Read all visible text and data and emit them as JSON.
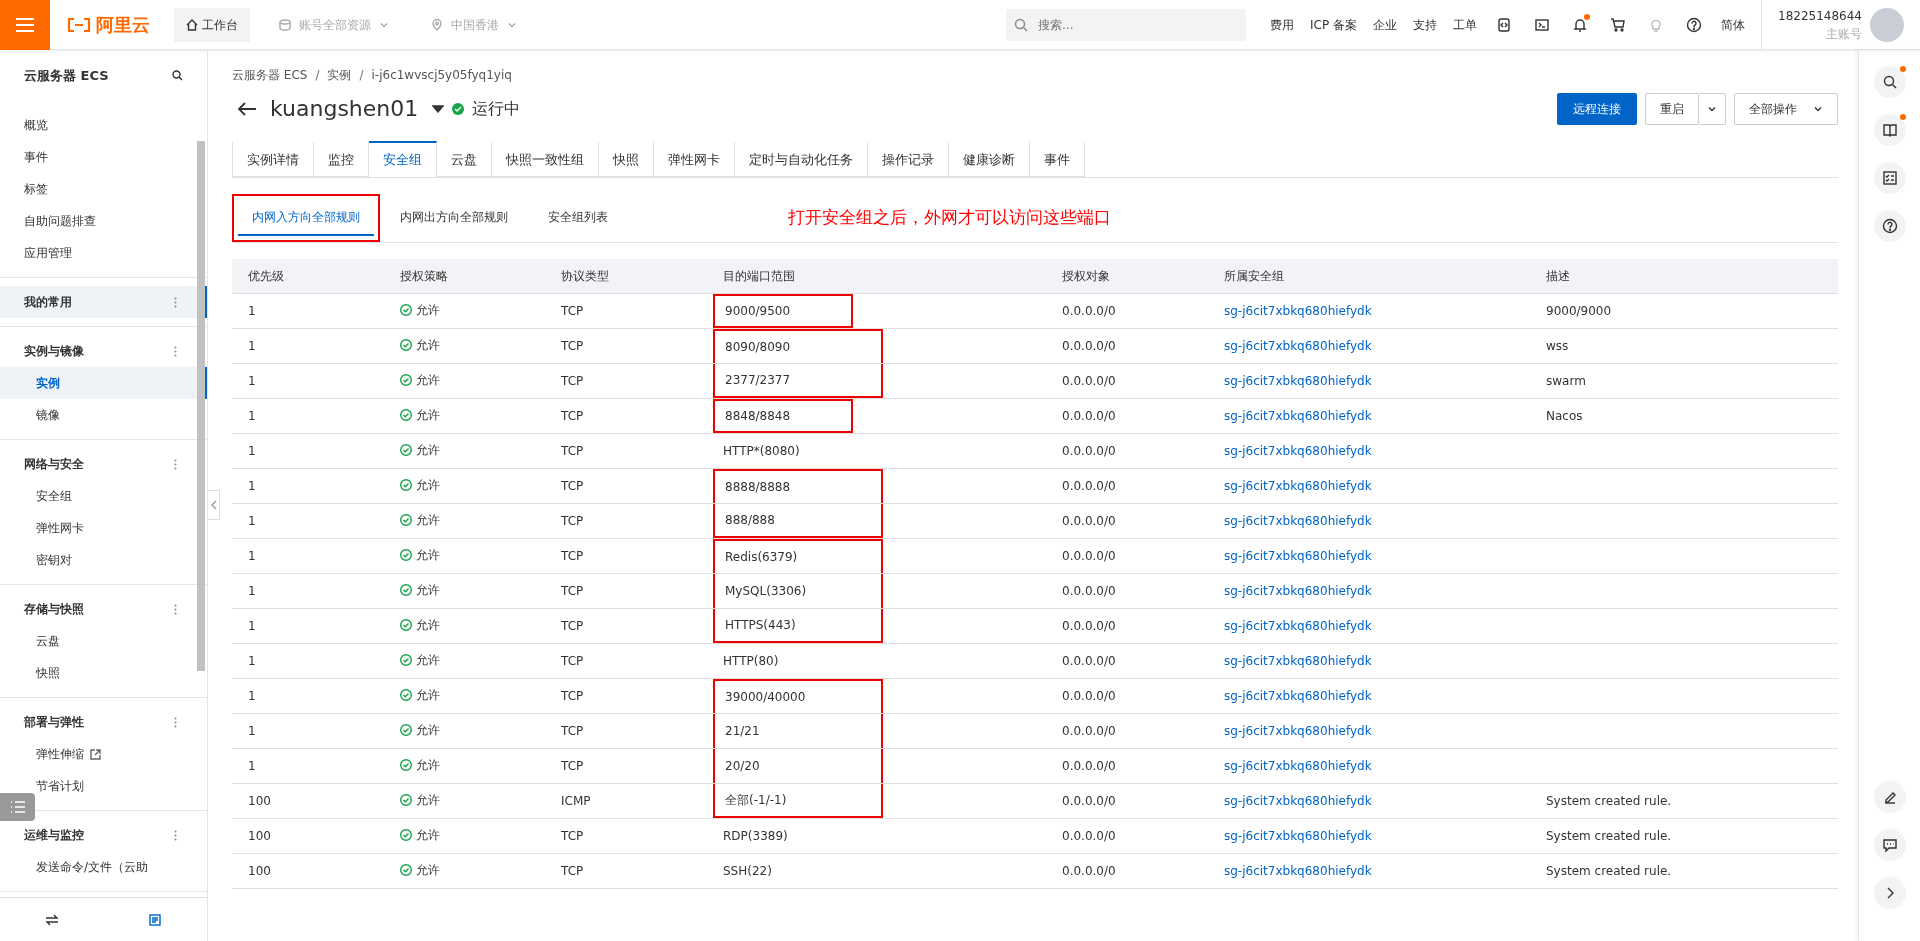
{
  "top_bar": {
    "logo": "阿里云",
    "workbench": "工作台",
    "resource_scope": "账号全部资源",
    "region": "中国香港",
    "search": {
      "placeholder": "搜索..."
    },
    "links": [
      "费用",
      "ICP 备案",
      "企业",
      "支持",
      "工单"
    ],
    "icons": [
      {
        "kind": "code",
        "badge": false
      },
      {
        "kind": "terminal",
        "badge": false
      },
      {
        "kind": "bell",
        "badge": true
      },
      {
        "kind": "cart",
        "badge": false
      },
      {
        "kind": "bulb",
        "badge": false
      },
      {
        "kind": "help",
        "badge": false
      }
    ],
    "language": "简体",
    "user": {
      "account": "18225148644",
      "role": "主账号"
    }
  },
  "sidebar": {
    "title": "云服务器 ECS",
    "sections": [
      {
        "items": [
          {
            "label": "概览",
            "selected": false,
            "external": false
          },
          {
            "label": "事件",
            "selected": false,
            "external": false
          },
          {
            "label": "标签",
            "selected": false,
            "external": false
          },
          {
            "label": "自助问题排查",
            "selected": false,
            "external": false
          },
          {
            "label": "应用管理",
            "selected": false,
            "external": false
          }
        ]
      },
      {
        "heading": "我的常用",
        "selected": true
      },
      {
        "heading": "实例与镜像",
        "selected": false,
        "items": [
          {
            "label": "实例",
            "selected": true,
            "external": false
          },
          {
            "label": "镜像",
            "selected": false,
            "external": false
          }
        ]
      },
      {
        "heading": "网络与安全",
        "selected": false,
        "items": [
          {
            "label": "安全组",
            "selected": false,
            "external": false
          },
          {
            "label": "弹性网卡",
            "selected": false,
            "external": false
          },
          {
            "label": "密钥对",
            "selected": false,
            "external": false
          }
        ]
      },
      {
        "heading": "存储与快照",
        "selected": false,
        "items": [
          {
            "label": "云盘",
            "selected": false,
            "external": false
          },
          {
            "label": "快照",
            "selected": false,
            "external": false
          }
        ]
      },
      {
        "heading": "部署与弹性",
        "selected": false,
        "items": [
          {
            "label": "弹性伸缩",
            "selected": false,
            "external": true
          },
          {
            "label": "节省计划",
            "selected": false,
            "external": false
          }
        ]
      },
      {
        "heading": "运维与监控",
        "selected": false,
        "items": [
          {
            "label": "发送命令/文件（云助",
            "selected": false,
            "external": false
          }
        ]
      }
    ]
  },
  "breadcrumb": [
    {
      "label": "云服务器 ECS",
      "separator": "/"
    },
    {
      "label": "实例",
      "separator": "/"
    },
    {
      "label": "i-j6c1wvscj5y05fyq1yiq"
    }
  ],
  "instance": {
    "name": "kuangshen01",
    "status": "运行中"
  },
  "actions": {
    "primary": "远程连接",
    "restart": "重启",
    "all": "全部操作"
  },
  "tabs": [
    {
      "label": "实例详情",
      "selected": false
    },
    {
      "label": "监控",
      "selected": false
    },
    {
      "label": "安全组",
      "selected": true
    },
    {
      "label": "云盘",
      "selected": false
    },
    {
      "label": "快照一致性组",
      "selected": false
    },
    {
      "label": "快照",
      "selected": false
    },
    {
      "label": "弹性网卡",
      "selected": false
    },
    {
      "label": "定时与自动化任务",
      "selected": false
    },
    {
      "label": "操作记录",
      "selected": false
    },
    {
      "label": "健康诊断",
      "selected": false
    },
    {
      "label": "事件",
      "selected": false
    }
  ],
  "sub_tabs": [
    {
      "label": "内网入方向全部规则",
      "selected": true,
      "outlined": true
    },
    {
      "label": "内网出方向全部规则",
      "selected": false,
      "outlined": false
    },
    {
      "label": "安全组列表",
      "selected": false,
      "outlined": false
    }
  ],
  "annotation": "打开安全组之后，外网才可以访问这些端口",
  "table": {
    "columns": [
      "优先级",
      "授权策略",
      "协议类型",
      "目的端口范围",
      "授权对象",
      "所属安全组",
      "描述"
    ],
    "rows": [
      {
        "priority": "1",
        "policy": "允许",
        "protocol": "TCP",
        "port": "9000/9500",
        "source": "0.0.0.0/0",
        "group": "sg-j6cit7xbkq680hiefydk",
        "description": "9000/9000",
        "boxed": true,
        "box_top": true,
        "box_bottom": true
      },
      {
        "priority": "1",
        "policy": "允许",
        "protocol": "TCP",
        "port": "8090/8090",
        "source": "0.0.0.0/0",
        "group": "sg-j6cit7xbkq680hiefydk",
        "description": "wss",
        "boxed": true,
        "box_top": true,
        "box_bottom": false
      },
      {
        "priority": "1",
        "policy": "允许",
        "protocol": "TCP",
        "port": "2377/2377",
        "source": "0.0.0.0/0",
        "group": "sg-j6cit7xbkq680hiefydk",
        "description": "swarm",
        "boxed": true,
        "box_top": false,
        "box_bottom": true
      },
      {
        "priority": "1",
        "policy": "允许",
        "protocol": "TCP",
        "port": "8848/8848",
        "source": "0.0.0.0/0",
        "group": "sg-j6cit7xbkq680hiefydk",
        "description": "Nacos",
        "boxed": true,
        "box_top": true,
        "box_bottom": true
      },
      {
        "priority": "1",
        "policy": "允许",
        "protocol": "TCP",
        "port": "HTTP*(8080)",
        "source": "0.0.0.0/0",
        "group": "sg-j6cit7xbkq680hiefydk",
        "boxed": false,
        "box_top": false,
        "box_bottom": false
      },
      {
        "priority": "1",
        "policy": "允许",
        "protocol": "TCP",
        "port": "8888/8888",
        "source": "0.0.0.0/0",
        "group": "sg-j6cit7xbkq680hiefydk",
        "boxed": true,
        "box_top": true,
        "box_bottom": false
      },
      {
        "priority": "1",
        "policy": "允许",
        "protocol": "TCP",
        "port": "888/888",
        "source": "0.0.0.0/0",
        "group": "sg-j6cit7xbkq680hiefydk",
        "boxed": true,
        "box_top": false,
        "box_bottom": true
      },
      {
        "priority": "1",
        "policy": "允许",
        "protocol": "TCP",
        "port": "Redis(6379)",
        "source": "0.0.0.0/0",
        "group": "sg-j6cit7xbkq680hiefydk",
        "boxed": true,
        "box_top": true,
        "box_bottom": false
      },
      {
        "priority": "1",
        "policy": "允许",
        "protocol": "TCP",
        "port": "MySQL(3306)",
        "source": "0.0.0.0/0",
        "group": "sg-j6cit7xbkq680hiefydk",
        "boxed": true,
        "box_top": false,
        "box_bottom": false
      },
      {
        "priority": "1",
        "policy": "允许",
        "protocol": "TCP",
        "port": "HTTPS(443)",
        "source": "0.0.0.0/0",
        "group": "sg-j6cit7xbkq680hiefydk",
        "boxed": true,
        "box_top": false,
        "box_bottom": true
      },
      {
        "priority": "1",
        "policy": "允许",
        "protocol": "TCP",
        "port": "HTTP(80)",
        "source": "0.0.0.0/0",
        "group": "sg-j6cit7xbkq680hiefydk",
        "boxed": false,
        "box_top": false,
        "box_bottom": false
      },
      {
        "priority": "1",
        "policy": "允许",
        "protocol": "TCP",
        "port": "39000/40000",
        "source": "0.0.0.0/0",
        "group": "sg-j6cit7xbkq680hiefydk",
        "boxed": true,
        "box_top": true,
        "box_bottom": false
      },
      {
        "priority": "1",
        "policy": "允许",
        "protocol": "TCP",
        "port": "21/21",
        "source": "0.0.0.0/0",
        "group": "sg-j6cit7xbkq680hiefydk",
        "boxed": true,
        "box_top": false,
        "box_bottom": false
      },
      {
        "priority": "1",
        "policy": "允许",
        "protocol": "TCP",
        "port": "20/20",
        "source": "0.0.0.0/0",
        "group": "sg-j6cit7xbkq680hiefydk",
        "boxed": true,
        "box_top": false,
        "box_bottom": false
      },
      {
        "priority": "100",
        "policy": "允许",
        "protocol": "ICMP",
        "port": "全部(-1/-1)",
        "source": "0.0.0.0/0",
        "group": "sg-j6cit7xbkq680hiefydk",
        "description": "System created rule.",
        "boxed": true,
        "box_top": false,
        "box_bottom": true
      },
      {
        "priority": "100",
        "policy": "允许",
        "protocol": "TCP",
        "port": "RDP(3389)",
        "source": "0.0.0.0/0",
        "group": "sg-j6cit7xbkq680hiefydk",
        "description": "System created rule.",
        "boxed": false,
        "box_top": false,
        "box_bottom": false
      },
      {
        "priority": "100",
        "policy": "允许",
        "protocol": "TCP",
        "port": "SSH(22)",
        "source": "0.0.0.0/0",
        "group": "sg-j6cit7xbkq680hiefydk",
        "description": "System created rule.",
        "boxed": false,
        "box_top": false,
        "box_bottom": false
      }
    ]
  },
  "right_rail": {
    "top": [
      {
        "kind": "search",
        "badge": true
      },
      {
        "kind": "book",
        "badge": true
      },
      {
        "kind": "checklist",
        "badge": false
      },
      {
        "kind": "help",
        "badge": false
      }
    ],
    "bottom": [
      {
        "kind": "edit"
      },
      {
        "kind": "chat"
      },
      {
        "kind": "chevron"
      }
    ]
  }
}
